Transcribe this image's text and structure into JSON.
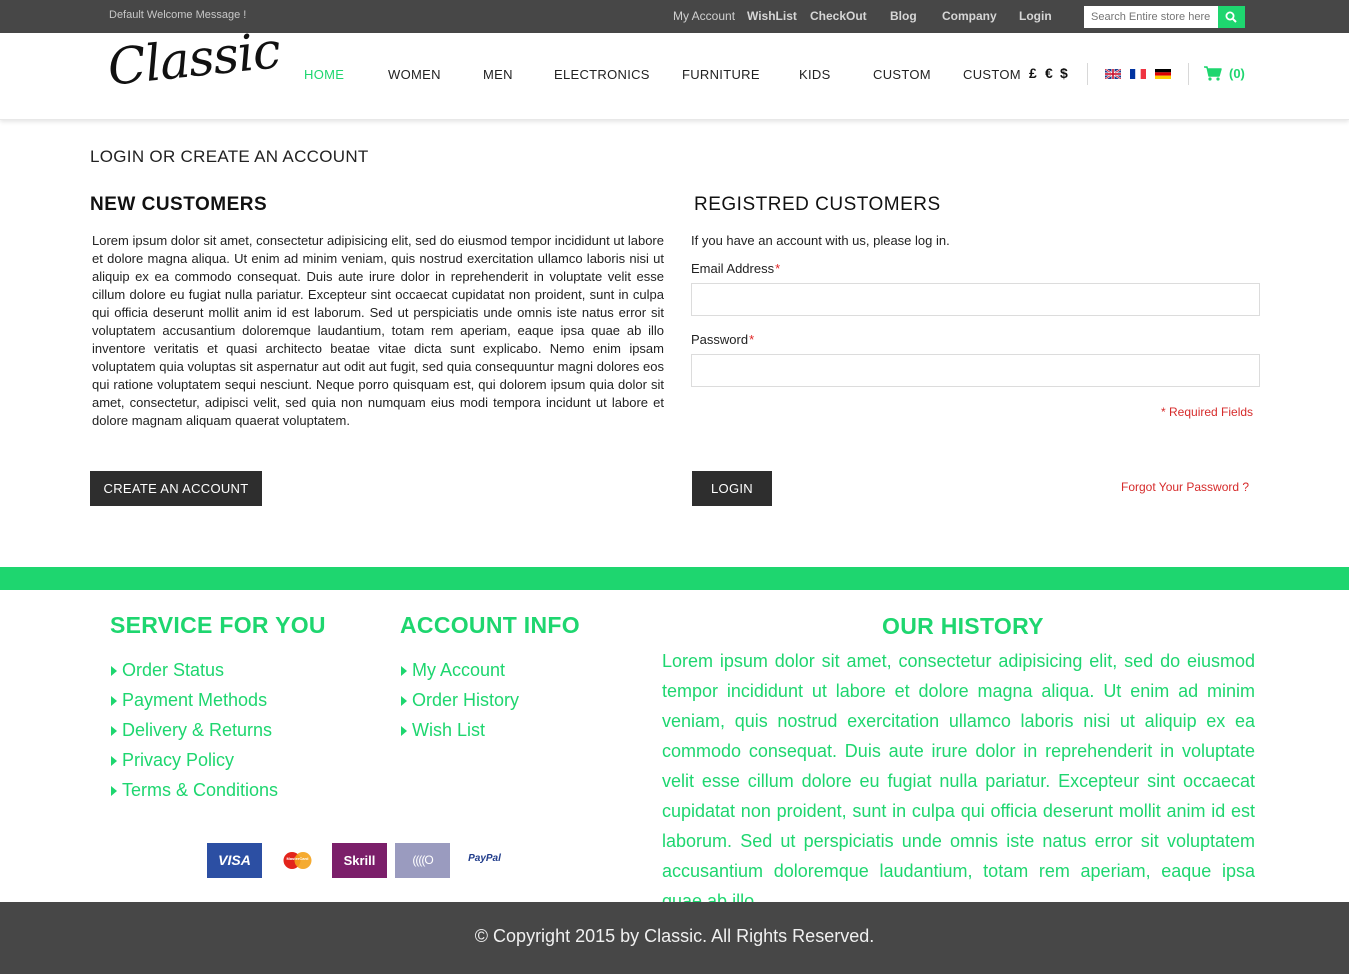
{
  "topbar": {
    "welcome": "Default Welcome Message !",
    "links": [
      "My Account",
      "WishList",
      "CheckOut",
      "Blog",
      "Company",
      "Login"
    ],
    "search_placeholder": "Search Entire store here"
  },
  "header": {
    "logo": "Classic",
    "nav": [
      "HOME",
      "WOMEN",
      "MEN",
      "ELECTRONICS",
      "FURNITURE",
      "KIDS",
      "CUSTOM",
      "CUSTOM"
    ],
    "currencies": [
      "£",
      "€",
      "$"
    ],
    "flags": [
      "uk-flag-icon",
      "france-flag-icon",
      "germany-flag-icon"
    ],
    "cart": "(0)"
  },
  "main": {
    "page_title": "LOGIN OR CREATE AN ACCOUNT",
    "new_customers": {
      "title": "NEW CUSTOMERS",
      "text": "Lorem ipsum dolor sit amet, consectetur adipisicing elit, sed do eiusmod tempor incididunt ut labore et dolore magna aliqua. Ut enim ad minim veniam, quis nostrud exercitation ullamco laboris nisi ut aliquip ex ea commodo consequat. Duis aute irure dolor in reprehenderit in voluptate velit esse cillum dolore eu fugiat nulla pariatur. Excepteur sint occaecat cupidatat non proident, sunt in culpa qui officia deserunt mollit anim id est laborum. Sed ut perspiciatis unde omnis iste natus error sit voluptatem accusantium doloremque laudantium, totam rem aperiam, eaque ipsa quae ab illo inventore veritatis et quasi architecto beatae vitae dicta sunt explicabo. Nemo enim ipsam voluptatem quia voluptas sit aspernatur aut odit aut fugit, sed quia consequuntur magni dolores eos qui ratione voluptatem sequi nesciunt. Neque porro quisquam est, qui dolorem ipsum quia dolor sit amet, consectetur, adipisci velit, sed quia non numquam eius modi tempora incidunt ut labore et dolore magnam aliquam quaerat voluptatem.",
      "button": "CREATE AN ACCOUNT"
    },
    "registered": {
      "title": "REGISTRED CUSTOMERS",
      "intro": "If you have an account with us, please log in.",
      "email_label": "Email Address",
      "email_value": "",
      "password_label": "Password",
      "password_value": "",
      "required_mark": "*",
      "required_note": "* Required Fields",
      "login_button": "LOGIN",
      "forgot": "Forgot Your Password ?"
    }
  },
  "footer": {
    "service": {
      "title": "SERVICE FOR YOU",
      "items": [
        "Order Status",
        "Payment Methods",
        "Delivery & Returns",
        "Privacy Policy",
        "Terms & Conditions"
      ]
    },
    "account": {
      "title": "ACCOUNT INFO",
      "items": [
        "My Account",
        "Order History",
        "Wish List"
      ]
    },
    "history": {
      "title": "OUR HISTORY",
      "text": "Lorem ipsum dolor sit amet, consectetur adipisicing elit, sed do eiusmod tempor incididunt ut labore et dolore magna aliqua. Ut enim ad minim veniam, quis nostrud exercitation ullamco laboris nisi ut aliquip ex ea commodo consequat. Duis aute irure dolor in reprehenderit in voluptate velit esse cillum dolore eu fugiat nulla pariatur. Excepteur sint occaecat cupidatat non proident, sunt in culpa qui officia deserunt mollit anim id est laborum. Sed ut perspiciatis unde omnis iste natus error sit voluptatem accusantium doloremque laudantium, totam rem aperiam, eaque ipsa quae ab illo."
    },
    "payments": [
      "VISA",
      "MasterCard",
      "Skrill",
      "((((O",
      "PayPal"
    ],
    "copyright": "© Copyright 2015 by Classic. All Rights Reserved."
  },
  "colors": {
    "accent": "#1ed66f",
    "topbar": "#474747",
    "button": "#2e2e2e",
    "required": "#d62b2b"
  }
}
